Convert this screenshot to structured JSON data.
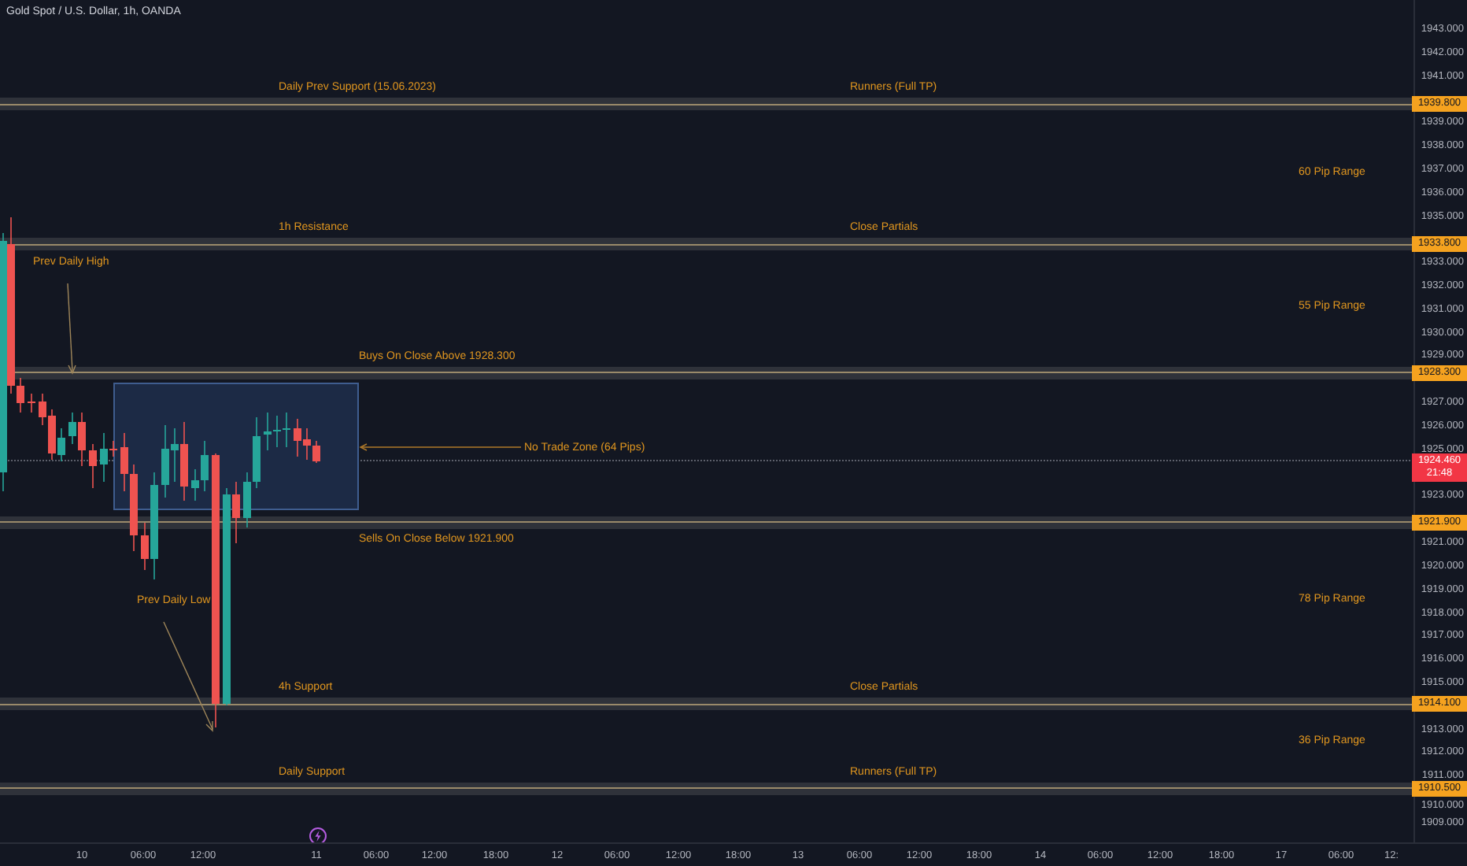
{
  "chart_title": "Gold Spot / U.S. Dollar, 1h, OANDA",
  "levels": [
    {
      "tag": "1939.800",
      "labels": [
        "Daily Prev Support (15.06.2023)",
        "Runners (Full TP)"
      ]
    },
    {
      "tag": "1933.800",
      "labels": [
        "1h Resistance",
        "Close Partials"
      ]
    },
    {
      "tag": "1928.300",
      "labels": [
        "Buys On Close Above 1928.300"
      ]
    },
    {
      "tag": "1921.900",
      "labels": [
        "Sells On Close Below 1921.900"
      ]
    },
    {
      "tag": "1914.100",
      "labels": [
        "4h Support",
        "Close Partials"
      ]
    },
    {
      "tag": "1910.500",
      "labels": [
        "Daily Support",
        "Runners (Full TP)"
      ]
    }
  ],
  "range_labels": [
    "60 Pip Range",
    "55 Pip Range",
    "78 Pip Range",
    "36 Pip Range"
  ],
  "annotations": [
    "Prev Daily High",
    "Prev Daily Low",
    "No Trade Zone (64 Pips)"
  ],
  "current_price": {
    "price": "1924.460",
    "countdown": "21:48"
  },
  "price_axis": [
    "1943.000",
    "1942.000",
    "1941.000",
    "1939.000",
    "1938.000",
    "1937.000",
    "1936.000",
    "1935.000",
    "1933.000",
    "1932.000",
    "1931.000",
    "1930.000",
    "1929.000",
    "1927.000",
    "1926.000",
    "1925.000",
    "1923.000",
    "1921.000",
    "1920.000",
    "1919.000",
    "1918.000",
    "1917.000",
    "1916.000",
    "1915.000",
    "1913.000",
    "1912.000",
    "1911.000",
    "1910.000",
    "1909.000"
  ],
  "time_axis": [
    "10",
    "06:00",
    "12:00",
    "11",
    "06:00",
    "12:00",
    "18:00",
    "12",
    "06:00",
    "12:00",
    "18:00",
    "13",
    "06:00",
    "12:00",
    "18:00",
    "14",
    "06:00",
    "12:00",
    "18:00",
    "17",
    "06:00",
    "12:"
  ]
}
